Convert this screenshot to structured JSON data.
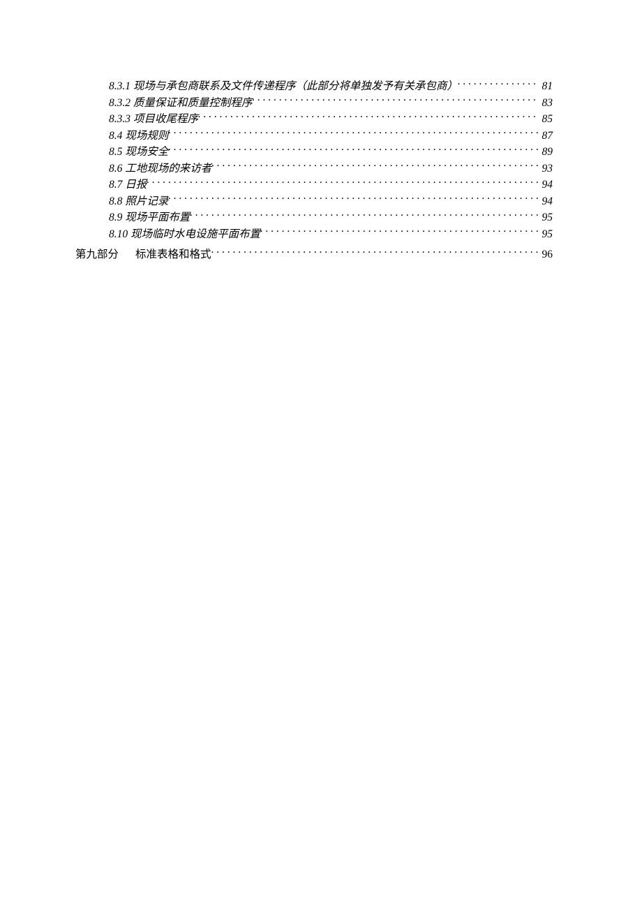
{
  "toc": {
    "sub_entries": [
      {
        "label": "8.3.1 现场与承包商联系及文件传递程序（此部分将单独发予有关承包商）",
        "page": "81"
      },
      {
        "label": "8.3.2 质量保证和质量控制程序",
        "page": "83"
      },
      {
        "label": "8.3.3 项目收尾程序",
        "page": "85"
      },
      {
        "label": "8.4 现场规则",
        "page": "87"
      },
      {
        "label": "8.5 现场安全",
        "page": "89"
      },
      {
        "label": "8.6 工地现场的来访者",
        "page": "93"
      },
      {
        "label": "8.7 日报",
        "page": "94"
      },
      {
        "label": "8.8 照片记录",
        "page": "94"
      },
      {
        "label": "8.9 现场平面布置",
        "page": "95"
      },
      {
        "label": "8.10 现场临时水电设施平面布置",
        "page": "95"
      }
    ],
    "section_entry": {
      "part": "第九部分",
      "title": "标准表格和格式",
      "page": "96"
    }
  }
}
